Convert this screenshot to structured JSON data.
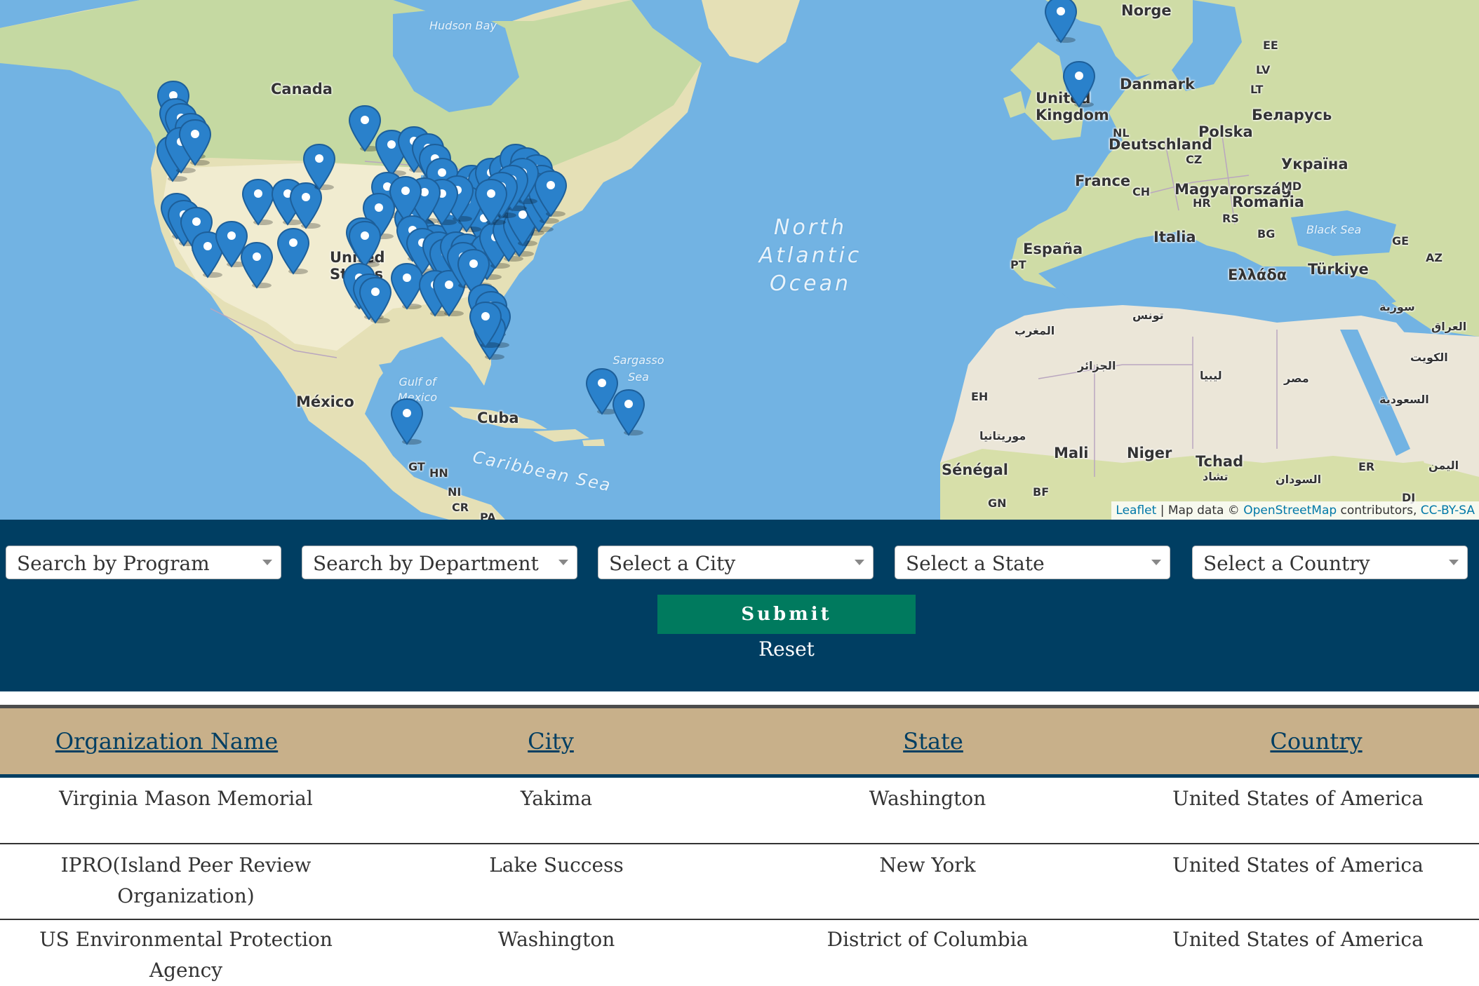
{
  "map": {
    "labels": {
      "canada": "Canada",
      "hudson_bay": "Hudson Bay",
      "united_states": "United States",
      "mexico": "México",
      "gulf_of_mexico": "Gulf of Mexico",
      "cuba": "Cuba",
      "caribbean_sea": "Caribbean Sea",
      "sargasso_sea": "Sargasso Sea",
      "north_atlantic_ocean": "North Atlantic Ocean",
      "hn": "HN",
      "ni": "NI",
      "cr": "CR",
      "gt": "GT",
      "pa": "PA",
      "norge": "Norge",
      "danmark": "Danmark",
      "united_kingdom": "United Kingdom",
      "ee": "EE",
      "lv": "LV",
      "lt": "LT",
      "belarus": "Беларусь",
      "polska": "Polska",
      "nl": "NL",
      "deutschland": "Deutschland",
      "cz": "CZ",
      "ukraine": "Україна",
      "france": "France",
      "ch": "CH",
      "magyarorszag": "Magyarország",
      "md": "MD",
      "hr": "HR",
      "romania": "Romania",
      "rs": "RS",
      "black_sea": "Black Sea",
      "bg": "BG",
      "italia": "Italia",
      "espana": "España",
      "pt": "PT",
      "ge": "GE",
      "az": "AZ",
      "ellada": "Ελλάδα",
      "turkiye": "Türkiye",
      "tunisia": "تونس",
      "syria": "سورية",
      "morocco": "المغرب",
      "iraq": "العراق",
      "algeria": "الجزائر",
      "libya": "ليبيا",
      "egypt": "مصر",
      "kuwait": "الكويت",
      "saudi": "السعودية",
      "eh": "EH",
      "mauritania": "موريتانيا",
      "mali": "Mali",
      "niger": "Niger",
      "tchad": "Tchad",
      "chad_ar": "تشاد",
      "senegal": "Sénégal",
      "sudan": "السودان",
      "er": "ER",
      "yemen": "اليمن",
      "bf": "BF",
      "gn": "GN",
      "dj": "DJ"
    },
    "attribution": {
      "leaflet": "Leaflet",
      "sep": " | Map data © ",
      "osm": "OpenStreetMap",
      "contributors": " contributors, ",
      "license": "CC-BY-SA"
    },
    "marker_color": "#2a81cb",
    "marker_count": 90
  },
  "search": {
    "program": "Search by Program",
    "department": "Search by Department",
    "city": "Select a City",
    "state": "Select a State",
    "country": "Select a Country",
    "submit": "Submit",
    "reset": "Reset"
  },
  "table": {
    "headers": {
      "name": "Organization Name",
      "city": "City",
      "state": "State",
      "country": "Country"
    },
    "rows": [
      {
        "name": "Virginia Mason Memorial",
        "city": "Yakima",
        "state": "Washington",
        "country": "United States of America"
      },
      {
        "name": "IPRO(Island Peer Review Organization)",
        "city": "Lake Success",
        "state": "New York",
        "country": "United States of America"
      },
      {
        "name": "US Environmental Protection Agency",
        "city": "Washington",
        "state": "District of Columbia",
        "country": "United States of America"
      }
    ]
  },
  "colors": {
    "panel": "#003e62",
    "submit": "#007a5e",
    "table_header": "#c8b08a",
    "water": "#72b3e3"
  }
}
